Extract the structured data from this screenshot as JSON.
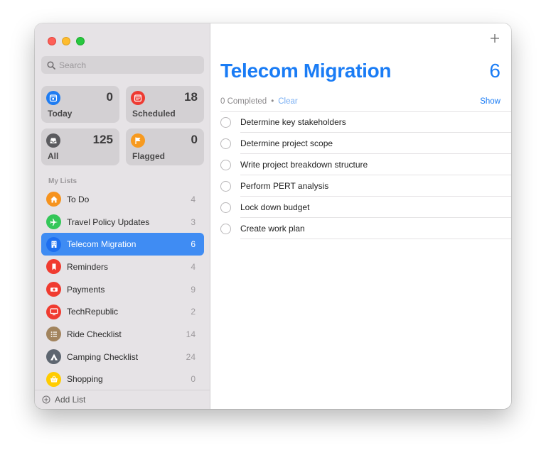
{
  "sidebar": {
    "search": {
      "placeholder": "Search",
      "value": ""
    },
    "smart_lists": [
      {
        "label": "Today",
        "count": "0",
        "color": "#1e7cf2",
        "icon": "calendar-today-icon"
      },
      {
        "label": "Scheduled",
        "count": "18",
        "color": "#ee3b32",
        "icon": "calendar-scheduled-icon"
      },
      {
        "label": "All",
        "count": "125",
        "color": "#5b5b5f",
        "icon": "tray-icon"
      },
      {
        "label": "Flagged",
        "count": "0",
        "color": "#f79a1f",
        "icon": "flag-icon"
      }
    ],
    "my_lists_header": "My Lists",
    "lists": [
      {
        "name": "To Do",
        "count": "4",
        "color": "#f6931e",
        "icon": "house-icon"
      },
      {
        "name": "Travel Policy Updates",
        "count": "3",
        "color": "#34c759",
        "icon": "airplane-icon"
      },
      {
        "name": "Telecom Migration",
        "count": "6",
        "color": "#1e6ff0",
        "icon": "building-icon",
        "selected": true
      },
      {
        "name": "Reminders",
        "count": "4",
        "color": "#f03b30",
        "icon": "bookmark-icon"
      },
      {
        "name": "Payments",
        "count": "9",
        "color": "#f03b30",
        "icon": "money-icon"
      },
      {
        "name": "TechRepublic",
        "count": "2",
        "color": "#f03b30",
        "icon": "monitor-icon"
      },
      {
        "name": "Ride Checklist",
        "count": "14",
        "color": "#a2845e",
        "icon": "list-bullet-icon"
      },
      {
        "name": "Camping Checklist",
        "count": "24",
        "color": "#5e6670",
        "icon": "tent-icon"
      },
      {
        "name": "Shopping",
        "count": "0",
        "color": "#ffcc00",
        "icon": "basket-icon"
      }
    ],
    "add_list_label": "Add List"
  },
  "main": {
    "title": "Telecom Migration",
    "total_count": "6",
    "completed_text": "0 Completed",
    "separator": "•",
    "clear_label": "Clear",
    "show_label": "Show",
    "accent_color": "#1a7cf5",
    "tasks": [
      "Determine key stakeholders",
      "Determine project scope",
      "Write project breakdown structure",
      "Perform PERT analysis",
      "Lock down budget",
      "Create work plan"
    ]
  }
}
